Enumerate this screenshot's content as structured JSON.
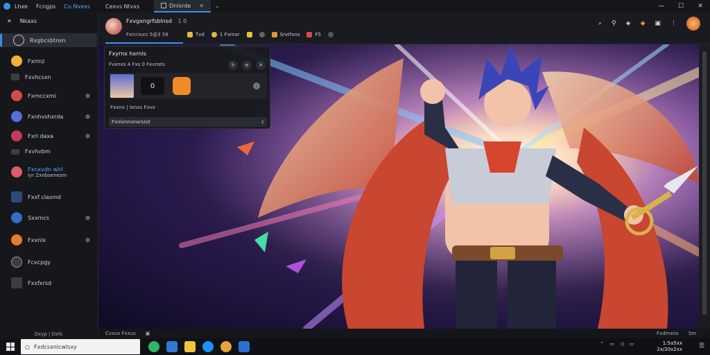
{
  "titlebar": {
    "menu": [
      "Lhxe",
      "Fcngps",
      "Cu Nvexs"
    ],
    "tabs": [
      {
        "label": "Cexvs Ntvxs",
        "active": false
      },
      {
        "label": "Dnlxrde",
        "active": true
      }
    ]
  },
  "sidebar": {
    "header": "Nkaxs",
    "items": [
      {
        "label": "Rxgbcsbtnsn",
        "active": true
      },
      {
        "label": "Fxrmz"
      },
      {
        "label": "Fxvhcsxn"
      },
      {
        "label": "Fxmccxmi"
      },
      {
        "label": "Fxnhvshxrda"
      },
      {
        "label": "Fxrl daxa"
      },
      {
        "label": "Fxvhvbm"
      },
      {
        "label": "Fxnxvdn wlrl",
        "sub": "Iyr Zxnbsenesm"
      },
      {
        "label": "Fxxf clasmd"
      },
      {
        "label": "Sxxmcs"
      },
      {
        "label": "Fxxnlx"
      },
      {
        "label": "Fcvcpgy"
      },
      {
        "label": "Fxxfxrsd"
      }
    ],
    "footer": "Dxyp | Dxfs"
  },
  "main_top": {
    "title": "Fxvgxngrfsblnsd",
    "title_count": "1 0",
    "subtitle": "Fxrcnsxn 5@3 58",
    "tools": [
      "Tvd",
      "1 Fxmxr",
      "",
      "",
      "Srvtfxns",
      "F5"
    ]
  },
  "popover": {
    "title": "Fxyrnx hxrnls",
    "meta": "Fvxnxs 4 Fxs   0   Fxvnsts",
    "count": "0",
    "caption": "Fxxnx  |  Ixnxs Fxvx",
    "input_value": "Fxnlxnnxnsrsnd",
    "input_suffix": "c"
  },
  "status_bar": {
    "left": "Cvxsa Fxxus",
    "items": [
      "Fxdmxns",
      "5m"
    ]
  },
  "taskbar": {
    "search_placeholder": "Fxdcsxnlcwlsxy",
    "clock_time": "1:5a5xx",
    "clock_date": "2x/20x2xx"
  },
  "colors": {
    "accent": "#3b8eea",
    "sidebar_bg": "#16171b",
    "topbar_bg": "#1a1b20"
  }
}
